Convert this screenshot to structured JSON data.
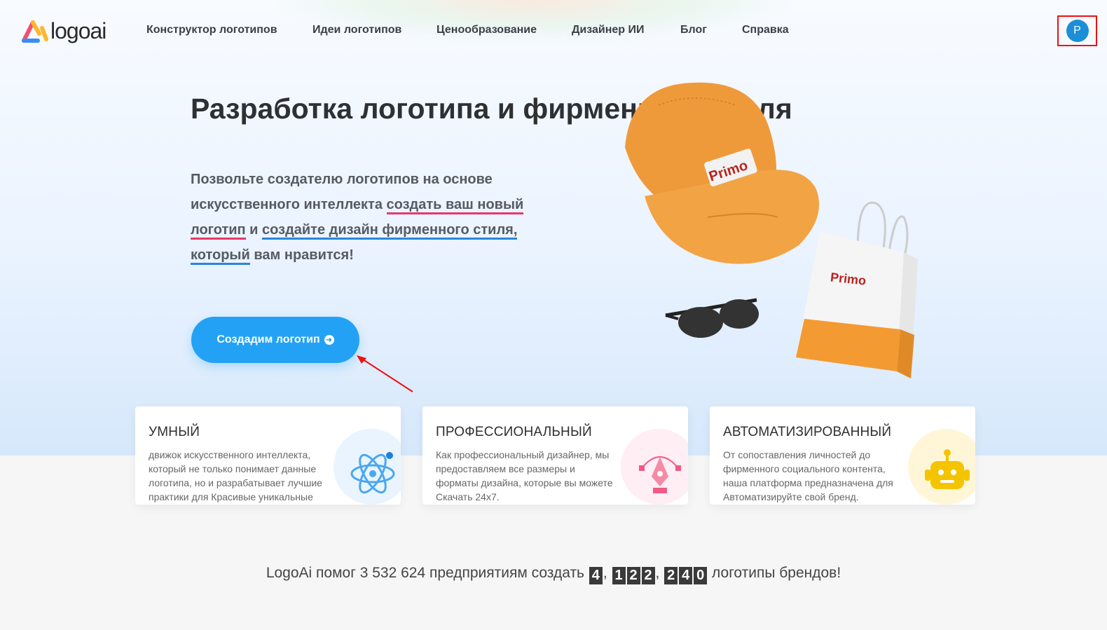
{
  "logo": {
    "text": "logoai"
  },
  "nav": [
    {
      "label": "Конструктор логотипов"
    },
    {
      "label": "Идеи логотипов"
    },
    {
      "label": "Ценообразование"
    },
    {
      "label": "Дизайнер ИИ"
    },
    {
      "label": "Блог"
    },
    {
      "label": "Справка"
    }
  ],
  "user": {
    "initial": "P"
  },
  "hero": {
    "title": "Разработка логотипа и фирменного стиля",
    "lead_1": "Позвольте создателю логотипов на основе искусственного интеллекта ",
    "lead_link_1a": "создать ваш новый",
    "lead_link_1b": "логотип",
    "lead_mid": " и ",
    "lead_link_2a": "создайте дизайн фирменного стиля,",
    "lead_link_2b": "который",
    "lead_end": " вам нравится!",
    "cta": "Создадим логотип",
    "product_brand": "Primo"
  },
  "cards": [
    {
      "title": "УМНЫЙ",
      "text": "движок искусственного интеллекта, который не только понимает данные логотипа, но и разрабатывает лучшие практики для Красивые уникальные",
      "icon": "atom-icon",
      "color": "#eaf4ff"
    },
    {
      "title": "ПРОФЕССИОНАЛЬНЫЙ",
      "text": "Как профессиональный дизайнер, мы предоставляем все размеры и форматы дизайна, которые вы можете Скачать 24x7.",
      "icon": "pen-tool-icon",
      "color": "#ffeef3"
    },
    {
      "title": "АВТОМАТИЗИРОВАННЫЙ",
      "text": "От сопоставления личностей до фирменного социального контента, наша платформа предназначена для Автоматизируйте свой бренд.",
      "icon": "robot-icon",
      "color": "#fff6d8"
    }
  ],
  "counter": {
    "prefix": "LogoAi помог 3 532 624 предприятиям создать",
    "digits_1": [
      "4"
    ],
    "digits_2": [
      "1",
      "2",
      "2"
    ],
    "digits_3": [
      "2",
      "4",
      "0"
    ],
    "suffix": "логотипы брендов!"
  },
  "colors": {
    "accent": "#23a2f5",
    "underline_red": "#e8386c",
    "underline_blue": "#2a86d9",
    "avatar": "#1a8fd8"
  }
}
